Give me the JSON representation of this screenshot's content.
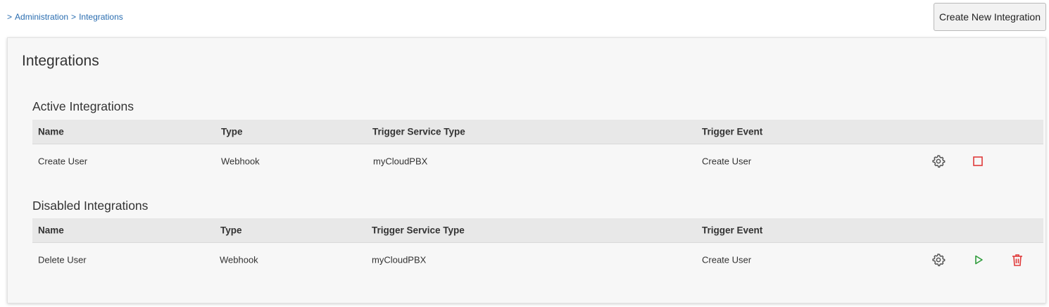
{
  "breadcrumb": {
    "sep": ">",
    "admin": "Administration",
    "current": "Integrations"
  },
  "header": {
    "create_label": "Create New Integration"
  },
  "page": {
    "title": "Integrations"
  },
  "columns": [
    "Name",
    "Type",
    "Trigger Service Type",
    "Trigger Event"
  ],
  "active": {
    "title": "Active Integrations",
    "rows": [
      {
        "name": "Create User",
        "type": "Webhook",
        "service": "myCloudPBX",
        "event": "Create User",
        "actions": [
          "gear-icon",
          "stop-icon"
        ]
      }
    ]
  },
  "disabled": {
    "title": "Disabled Integrations",
    "rows": [
      {
        "name": "Delete User",
        "type": "Webhook",
        "service": "myCloudPBX",
        "event": "Create User",
        "actions": [
          "gear-icon",
          "play-icon",
          "trash-icon"
        ]
      }
    ]
  },
  "colors": {
    "link": "#2a6db0",
    "stop": "#e03a3a",
    "play": "#2e9b3a",
    "trash": "#e03a3a",
    "gear": "#555555"
  }
}
